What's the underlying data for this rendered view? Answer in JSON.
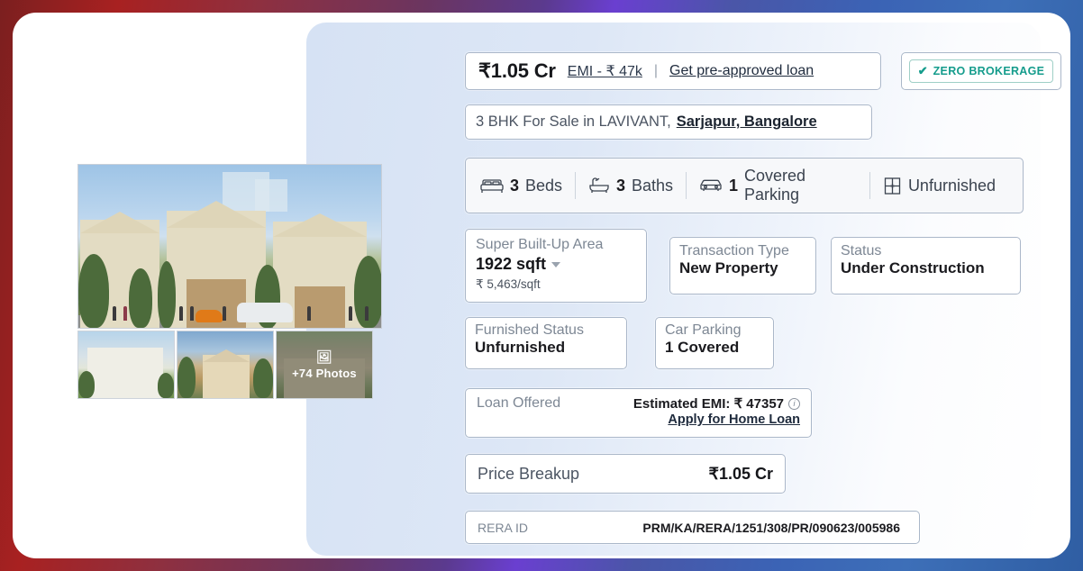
{
  "price": {
    "amount": "₹1.05 Cr",
    "emi_link": "EMI - ₹ 47k",
    "separator": "|",
    "preapproved_link": "Get pre-approved loan"
  },
  "brokerage_badge": {
    "check": "✔",
    "label": "ZERO BROKERAGE"
  },
  "title": {
    "text": "3 BHK For Sale in LAVIVANT,",
    "location": "Sarjapur, Bangalore"
  },
  "features": [
    {
      "icon": "bed-icon",
      "count": "3",
      "label": "Beds"
    },
    {
      "icon": "bathtub-icon",
      "count": "3",
      "label": "Baths"
    },
    {
      "icon": "car-icon",
      "count": "1",
      "label": "Covered Parking"
    },
    {
      "icon": "window-icon",
      "count": "",
      "label": "Unfurnished"
    }
  ],
  "specs": {
    "area": {
      "label": "Super Built-Up Area",
      "value": "1922 sqft",
      "rate": "₹ 5,463/sqft"
    },
    "transaction": {
      "label": "Transaction Type",
      "value": "New Property"
    },
    "status": {
      "label": "Status",
      "value": "Under Construction"
    },
    "furnished": {
      "label": "Furnished Status",
      "value": "Unfurnished"
    },
    "parking": {
      "label": "Car Parking",
      "value": "1 Covered"
    }
  },
  "loan": {
    "label": "Loan Offered",
    "emi_text": "Estimated EMI: ₹ 47357",
    "info_icon": "i",
    "apply_link": "Apply for Home Loan"
  },
  "price_breakup": {
    "label": "Price Breakup",
    "value": "₹1.05 Cr"
  },
  "rera": {
    "label": "RERA ID",
    "value": "PRM/KA/RERA/1251/308/PR/090623/005986"
  },
  "gallery": {
    "photos_badge": "+74 Photos",
    "photos_icon": "🖼"
  },
  "colors": {
    "accent_teal": "#159c8c",
    "panel_blue": "#dce6f5",
    "card_border": "#aab7c9"
  }
}
